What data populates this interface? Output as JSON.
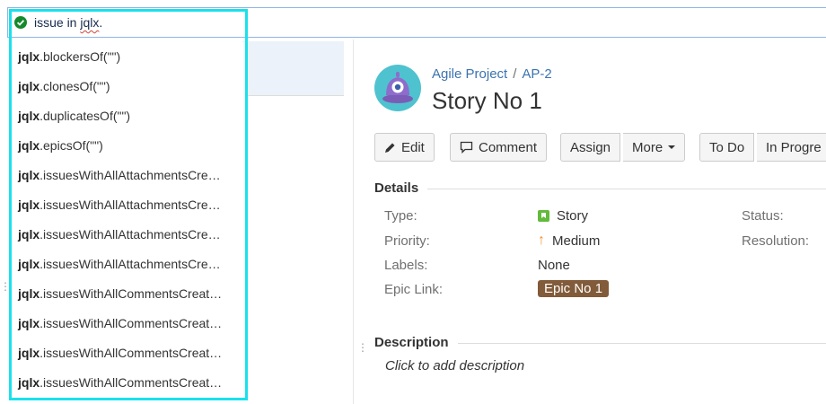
{
  "search": {
    "query_prefix": "issue in ",
    "query_word": "jqlx",
    "query_suffix": "."
  },
  "suggestions": [
    {
      "prefix": "jqlx",
      "rest": ".blockersOf(\"\")"
    },
    {
      "prefix": "jqlx",
      "rest": ".clonesOf(\"\")"
    },
    {
      "prefix": "jqlx",
      "rest": ".duplicatesOf(\"\")"
    },
    {
      "prefix": "jqlx",
      "rest": ".epicsOf(\"\")"
    },
    {
      "prefix": "jqlx",
      "rest": ".issuesWithAllAttachmentsCre…"
    },
    {
      "prefix": "jqlx",
      "rest": ".issuesWithAllAttachmentsCre…"
    },
    {
      "prefix": "jqlx",
      "rest": ".issuesWithAllAttachmentsCre…"
    },
    {
      "prefix": "jqlx",
      "rest": ".issuesWithAllAttachmentsCre…"
    },
    {
      "prefix": "jqlx",
      "rest": ".issuesWithAllCommentsCreat…"
    },
    {
      "prefix": "jqlx",
      "rest": ".issuesWithAllCommentsCreat…"
    },
    {
      "prefix": "jqlx",
      "rest": ".issuesWithAllCommentsCreat…"
    },
    {
      "prefix": "jqlx",
      "rest": ".issuesWithAllCommentsCreat…"
    }
  ],
  "issue": {
    "project": "Agile Project",
    "separator": "/",
    "key": "AP-2",
    "title": "Story No 1"
  },
  "toolbar": {
    "edit": "Edit",
    "comment": "Comment",
    "assign": "Assign",
    "more": "More",
    "todo": "To Do",
    "in_progress": "In Progre"
  },
  "details": {
    "heading": "Details",
    "type_label": "Type:",
    "type_value": "Story",
    "priority_label": "Priority:",
    "priority_value": "Medium",
    "labels_label": "Labels:",
    "labels_value": "None",
    "epic_label": "Epic Link:",
    "epic_value": "Epic No 1",
    "status_label": "Status:",
    "resolution_label": "Resolution:"
  },
  "description": {
    "heading": "Description",
    "placeholder": "Click to add description"
  },
  "colors": {
    "accent": "#3b73af",
    "highlight": "#19e1ec",
    "epic": "#815b3a",
    "story": "#63ba3c",
    "priority": "#f79232"
  }
}
